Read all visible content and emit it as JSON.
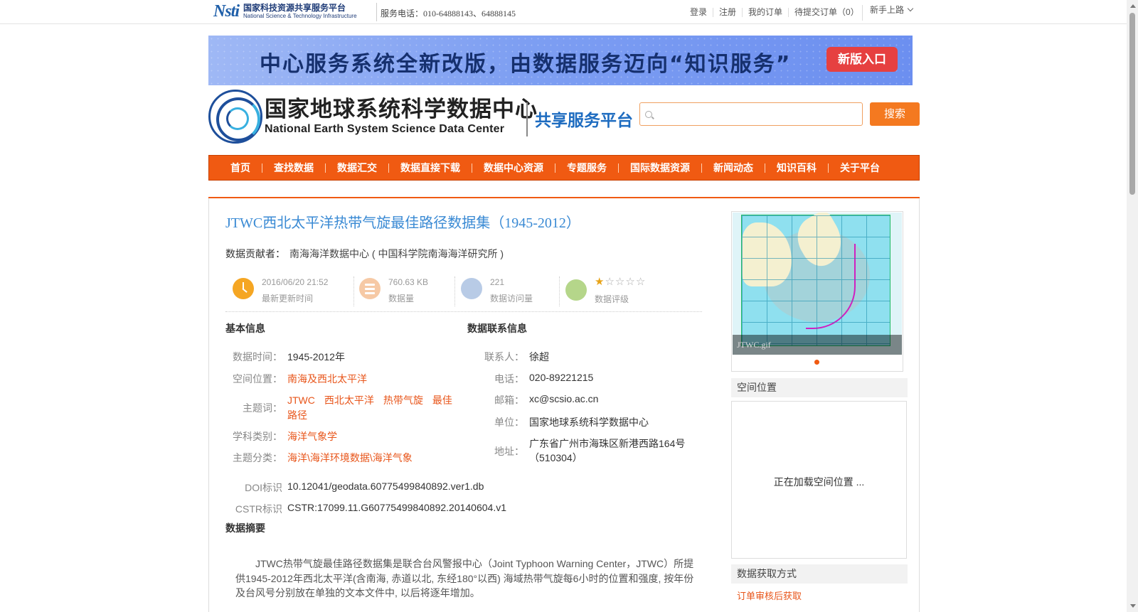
{
  "topbar": {
    "logo_cn": "国家科技资源共享服务平台",
    "logo_en": "National Science & Technology Infrastructure",
    "logo_mark": "Nsti",
    "phone": "服务电话：010-64888143、64888145",
    "links": [
      "登录",
      "注册",
      "我的订单",
      "待提交订单（0）"
    ],
    "newbie": "新手上路"
  },
  "banner": {
    "text": "中心服务系统全新改版，由数据服务迈向“知识服务”",
    "button": "新版入口"
  },
  "header": {
    "org_cn": "国家地球系统科学数据中心",
    "org_en": "National Earth System Science Data Center",
    "platform": "共享服务平台",
    "search_placeholder": "",
    "search_button": "搜索"
  },
  "nav": [
    "首页",
    "查找数据",
    "数据汇交",
    "数据直接下载",
    "数据中心资源",
    "专题服务",
    "国际数据资源",
    "新闻动态",
    "知识百科",
    "关于平台"
  ],
  "dataset": {
    "title": "JTWC西北太平洋热带气旋最佳路径数据集（1945-2012）",
    "contributor_label": "数据贡献者：",
    "contributor": "南海海洋数据中心 ( 中国科学院南海海洋研究所 )",
    "stats": {
      "updated": "2016/06/20 21:52",
      "updated_label": "最新更新时间",
      "size": "760.63 KB",
      "size_label": "数据量",
      "visits": "221",
      "visits_label": "数据访问量",
      "rating": 1,
      "rating_max": 5,
      "rating_label": "数据评级"
    }
  },
  "basic_info": {
    "heading": "基本信息",
    "time_label": "数据时间：",
    "time": "1945-2012年",
    "space_label": "空间位置：",
    "space": "南海及西北太平洋",
    "keywords_label": "主题词：",
    "keywords_line1": [
      "JTWC",
      "西北太平洋",
      "热带气旋",
      "最佳"
    ],
    "keywords_line2": "路径",
    "discipline_label": "学科类别：",
    "discipline": "海洋气象学",
    "category_label": "主题分类：",
    "category": "海洋\\海洋环境数据\\海洋气象",
    "doi_label": "DOI标识",
    "doi": "10.12041/geodata.60775499840892.ver1.db",
    "cstr_label": "CSTR标识",
    "cstr": "CSTR:17099.11.G60775499840892.20140604.v1"
  },
  "contact": {
    "heading": "数据联系信息",
    "person_label": "联系人：",
    "person": "徐超",
    "phone_label": "电话：",
    "phone": "020-89221215",
    "email_label": "邮箱：",
    "email": "xc@scsio.ac.cn",
    "unit_label": "单位：",
    "unit": "国家地球系统科学数据中心",
    "address_label": "地址：",
    "address_line1": "广东省广州市海珠区新港西路164号",
    "address_line2": "（510304）"
  },
  "abstract": {
    "heading": "数据摘要",
    "text": "JTWC热带气旋最佳路径数据集是联合台风警报中心（Joint Typhoon Warning Center，JTWC）所提供1945-2012年西北太平洋(含南海, 赤道以北, 东经180°以西) 海域热带气旋每6小时的位置和强度, 按年份及台风号分别放在单独的文本文件中, 以后将逐年增加。"
  },
  "sidebar": {
    "image_caption": "JTWC.gif",
    "spatial_heading": "空间位置",
    "spatial_loading": "正在加载空间位置 ...",
    "acquire_heading": "数据获取方式",
    "acquire_method": "订单审核后获取"
  },
  "colors": {
    "accent": "#f05a12",
    "title_blue": "#3a8ad4",
    "link_orange": "#e8551a",
    "clock": "#f5a623",
    "stack": "#f6c9a5",
    "visits": "#b8cbe6",
    "rating": "#b5d68a"
  }
}
